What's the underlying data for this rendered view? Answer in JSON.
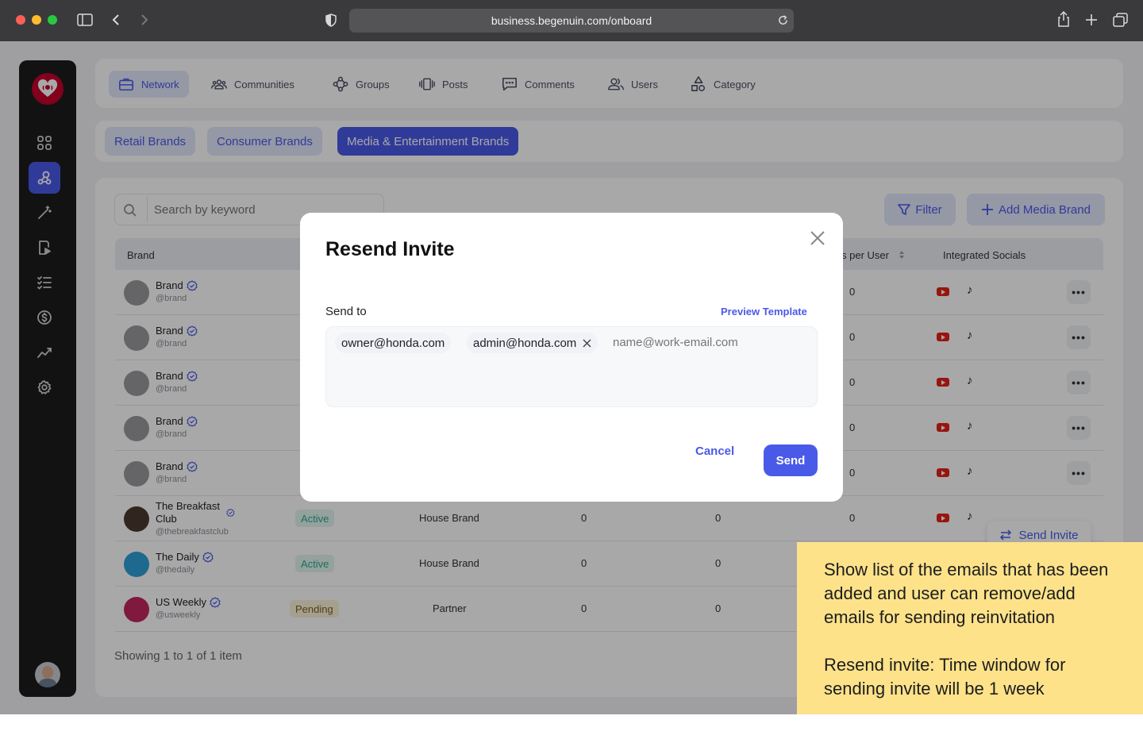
{
  "browser": {
    "url": "business.begenuin.com/onboard"
  },
  "nav": {
    "tabs": [
      {
        "label": "Network"
      },
      {
        "label": "Communities"
      },
      {
        "label": "Groups"
      },
      {
        "label": "Posts"
      },
      {
        "label": "Comments"
      },
      {
        "label": "Users"
      },
      {
        "label": "Category"
      }
    ]
  },
  "brand_tabs": [
    "Retail Brands",
    "Consumer Brands",
    "Media & Entertainment Brands"
  ],
  "toolbar": {
    "search_placeholder": "Search by keyword",
    "filter_label": "Filter",
    "add_label": "Add Media Brand"
  },
  "table": {
    "headers": {
      "brand": "Brand",
      "per_user": "s per User",
      "socials": "Integrated Socials"
    },
    "rows": [
      {
        "name": "Brand",
        "handle": "@brand",
        "status": "",
        "type": "",
        "c1": "",
        "c2": "",
        "c3": "0"
      },
      {
        "name": "Brand",
        "handle": "@brand",
        "status": "",
        "type": "",
        "c1": "",
        "c2": "",
        "c3": "0"
      },
      {
        "name": "Brand",
        "handle": "@brand",
        "status": "",
        "type": "",
        "c1": "",
        "c2": "",
        "c3": "0"
      },
      {
        "name": "Brand",
        "handle": "@brand",
        "status": "",
        "type": "",
        "c1": "",
        "c2": "",
        "c3": "0"
      },
      {
        "name": "Brand",
        "handle": "@brand",
        "status": "",
        "type": "",
        "c1": "",
        "c2": "",
        "c3": "0"
      },
      {
        "name": "The Breakfast Club",
        "handle": "@thebreakfastclub",
        "status": "Active",
        "type": "House Brand",
        "c1": "0",
        "c2": "0",
        "c3": "0"
      },
      {
        "name": "The Daily",
        "handle": "@thedaily",
        "status": "Active",
        "type": "House Brand",
        "c1": "0",
        "c2": "0",
        "c3": ""
      },
      {
        "name": "US Weekly",
        "handle": "@usweekly",
        "status": "Pending",
        "type": "Partner",
        "c1": "0",
        "c2": "0",
        "c3": ""
      }
    ],
    "more_glyph": "•••",
    "footer": "Showing 1 to 1 of 1 item",
    "send_invite_label": "Send Invite"
  },
  "modal": {
    "title": "Resend Invite",
    "send_to_label": "Send to",
    "preview_label": "Preview Template",
    "emails": [
      "owner@honda.com",
      "admin@honda.com"
    ],
    "email_placeholder": "name@work-email.com",
    "cancel_label": "Cancel",
    "send_label": "Send"
  },
  "annotation": {
    "line1": "Show list of the emails that has been added and user can remove/add emails for sending reinvitation",
    "line2": "Resend invite: Time window for sending invite will be 1 week"
  },
  "colors": {
    "accent": "#4a5ae8",
    "note_bg": "#fde28a",
    "active_badge": "#2fa88f",
    "pending_badge": "#9a7a1a"
  }
}
